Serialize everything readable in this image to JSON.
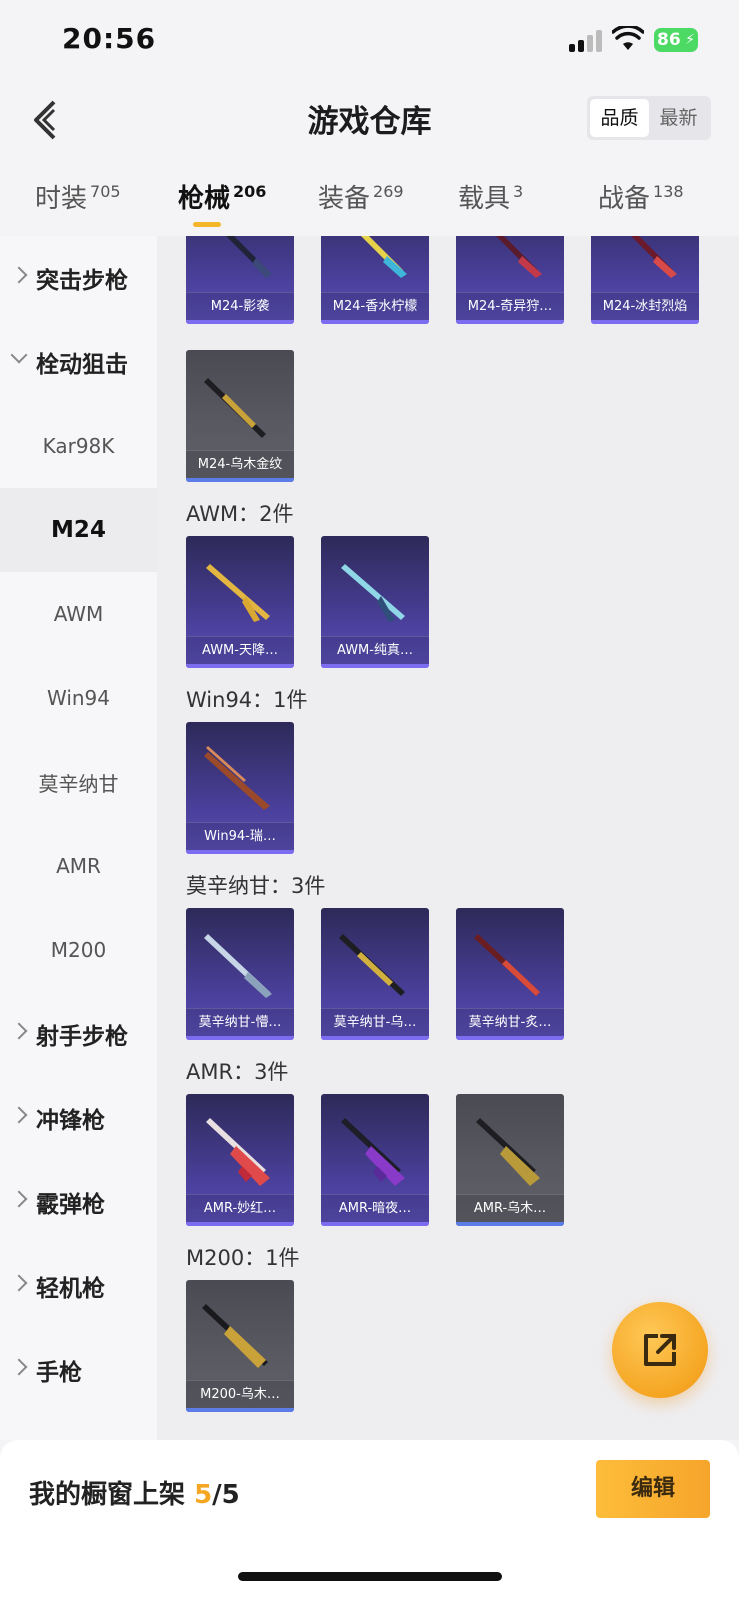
{
  "status_bar": {
    "time": "20:56",
    "battery": "86"
  },
  "header": {
    "title": "游戏仓库",
    "sort_options": [
      "品质",
      "最新"
    ],
    "active_sort": "品质"
  },
  "category_tabs": [
    {
      "label": "时装",
      "count": "705"
    },
    {
      "label": "枪械",
      "count": "206"
    },
    {
      "label": "装备",
      "count": "269"
    },
    {
      "label": "载具",
      "count": "3"
    },
    {
      "label": "战备",
      "count": "138"
    }
  ],
  "sidebar": [
    {
      "label": "突击步枪"
    },
    {
      "label": "栓动狙击"
    },
    {
      "label": "Kar98K"
    },
    {
      "label": "M24"
    },
    {
      "label": "AWM"
    },
    {
      "label": "Win94"
    },
    {
      "label": "莫辛纳甘"
    },
    {
      "label": "AMR"
    },
    {
      "label": "M200"
    },
    {
      "label": "射手步枪"
    },
    {
      "label": "冲锋枪"
    },
    {
      "label": "霰弹枪"
    },
    {
      "label": "轻机枪"
    },
    {
      "label": "手枪"
    }
  ],
  "sections": [
    {
      "items": [
        "M24-影袭",
        "M24-香水柠檬",
        "M24-奇异狩…",
        "M24-冰封烈焰",
        "M24-乌木金纹"
      ]
    },
    {
      "title": "AWM：2件",
      "items": [
        "AWM-天降…",
        "AWM-纯真…"
      ]
    },
    {
      "title": "Win94：1件",
      "items": [
        "Win94-瑞…"
      ]
    },
    {
      "title": "莫辛纳甘：3件",
      "items": [
        "莫辛纳甘-懵…",
        "莫辛纳甘-乌…",
        "莫辛纳甘-炙…"
      ]
    },
    {
      "title": "AMR：3件",
      "items": [
        "AMR-妙红…",
        "AMR-暗夜…",
        "AMR-乌木…"
      ]
    },
    {
      "title": "M200：1件",
      "items": [
        "M200-乌木…"
      ]
    }
  ],
  "footer": {
    "shelf_label": "我的橱窗上架",
    "shelf_current": "5",
    "shelf_total": "/5",
    "edit_label": "编辑"
  },
  "colors": {
    "accent": "#f5a623",
    "card_purple": "#4a3f9a",
    "card_grey": "#5a5a63"
  }
}
